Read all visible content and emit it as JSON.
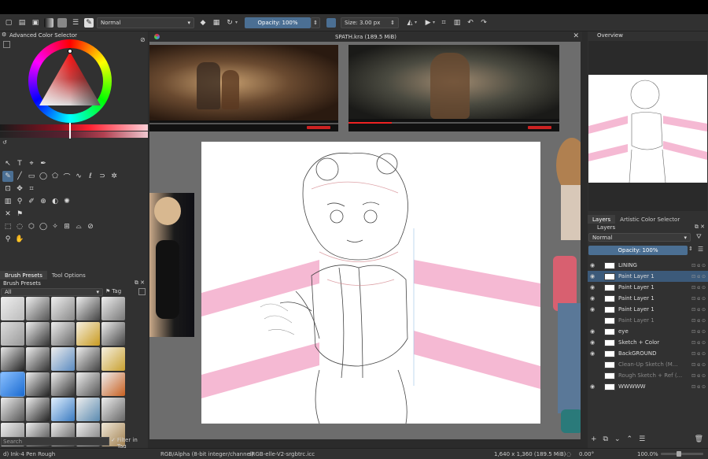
{
  "toolbar": {
    "blend_mode": "Normal",
    "opacity": "Opacity: 100%",
    "size": "Size: 3.00 px"
  },
  "left_panel": {
    "color_selector_title": "Advanced Color Selector",
    "tabs": [
      "Brush Presets",
      "Tool Options"
    ],
    "brush_presets_title": "Brush Presets",
    "filter_value": "All",
    "tag_label": "Tag",
    "search_placeholder": "Search",
    "filter_in_tag": "Filter in Tag"
  },
  "canvas": {
    "document_title": "SPATH.kra (189.5 MiB)"
  },
  "right_panel": {
    "overview_title": "Overview",
    "tabs": [
      "Layers",
      "Artistic Color Selector"
    ],
    "layers_title": "Layers",
    "blend_mode": "Normal",
    "opacity": "Opacity: 100%",
    "layers": [
      {
        "name": "LINING",
        "visible": true,
        "selected": false,
        "dim": false
      },
      {
        "name": "Paint Layer 1",
        "visible": true,
        "selected": true,
        "dim": false
      },
      {
        "name": "Paint Layer 1",
        "visible": true,
        "selected": false,
        "dim": false
      },
      {
        "name": "Paint Layer 1",
        "visible": true,
        "selected": false,
        "dim": false
      },
      {
        "name": "Paint Layer 1",
        "visible": true,
        "selected": false,
        "dim": false
      },
      {
        "name": "Paint Layer 1",
        "visible": false,
        "selected": false,
        "dim": true
      },
      {
        "name": "eye",
        "visible": true,
        "selected": false,
        "dim": false
      },
      {
        "name": "Sketch + Color",
        "visible": true,
        "selected": false,
        "dim": false
      },
      {
        "name": "BackGROUND",
        "visible": true,
        "selected": false,
        "dim": false
      },
      {
        "name": "Clean-Up Sketch (M...",
        "visible": false,
        "selected": false,
        "dim": true
      },
      {
        "name": "Rough Sketch + Ref (...",
        "visible": false,
        "selected": false,
        "dim": true
      },
      {
        "name": "WWWWW",
        "visible": true,
        "selected": false,
        "dim": false
      }
    ]
  },
  "statusbar": {
    "brush": "d) Ink-4 Pen Rough",
    "color_model": "RGB/Alpha (8-bit integer/channel)",
    "profile": "sRGB-elle-V2-srgbtrc.icc",
    "dimensions": "1,640 x 1,360 (189.5 MiB)",
    "rotation": "0.00°",
    "zoom": "100.0%"
  },
  "colors": {
    "accent": "#4b6f93",
    "panel": "#313131",
    "canvas_bg": "#6d6d6d",
    "pink": "#f5b9d3"
  }
}
